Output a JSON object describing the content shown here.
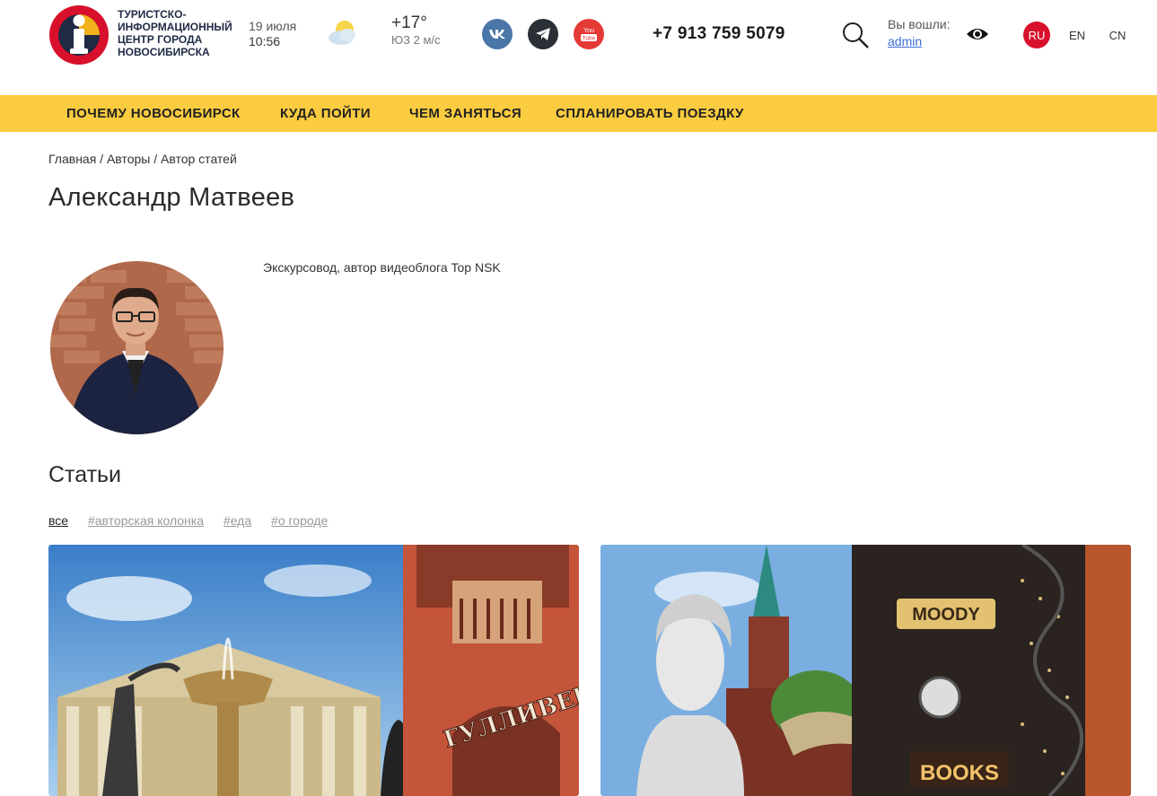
{
  "header": {
    "brand_lines": [
      "ТУРИСТСКО-",
      "ИНФОРМАЦИОННЫЙ",
      "ЦЕНТР ГОРОДА",
      "НОВОСИБИРСКА"
    ],
    "date": "19 июля",
    "time": "10:56",
    "weather_icon": "partly-cloudy-icon",
    "temperature": "+17°",
    "wind": "ЮЗ 2 м/с",
    "social": {
      "vk": "vk-icon",
      "telegram": "telegram-icon",
      "youtube_label": "You Tube"
    },
    "phone": "+7 913 759 5079",
    "login_label": "Вы вошли:",
    "user": "admin",
    "languages": [
      "RU",
      "EN",
      "CN"
    ]
  },
  "nav": {
    "items": [
      "ПОЧЕМУ НОВОСИБИРСК",
      "КУДА ПОЙТИ",
      "ЧЕМ ЗАНЯТЬСЯ",
      "СПЛАНИРОВАТЬ ПОЕЗДКУ"
    ]
  },
  "breadcrumb": [
    "Главная /",
    "Авторы /",
    "Автор статей"
  ],
  "author": {
    "name": "Александр Матвеев",
    "bio": "Экскурсовод, автор видеоблога Top NSK"
  },
  "articles": {
    "title": "Статьи",
    "tags": [
      "все",
      "#авторская колонка",
      "#еда",
      "#о городе"
    ],
    "card1_sign": "ГУЛЛИВЕР",
    "card2_signs": [
      "MOODY",
      "BOOKS"
    ]
  },
  "colors": {
    "accent": "#fbcc3f",
    "brand_red": "#d8102b",
    "brand_navy": "#1f2a44"
  }
}
